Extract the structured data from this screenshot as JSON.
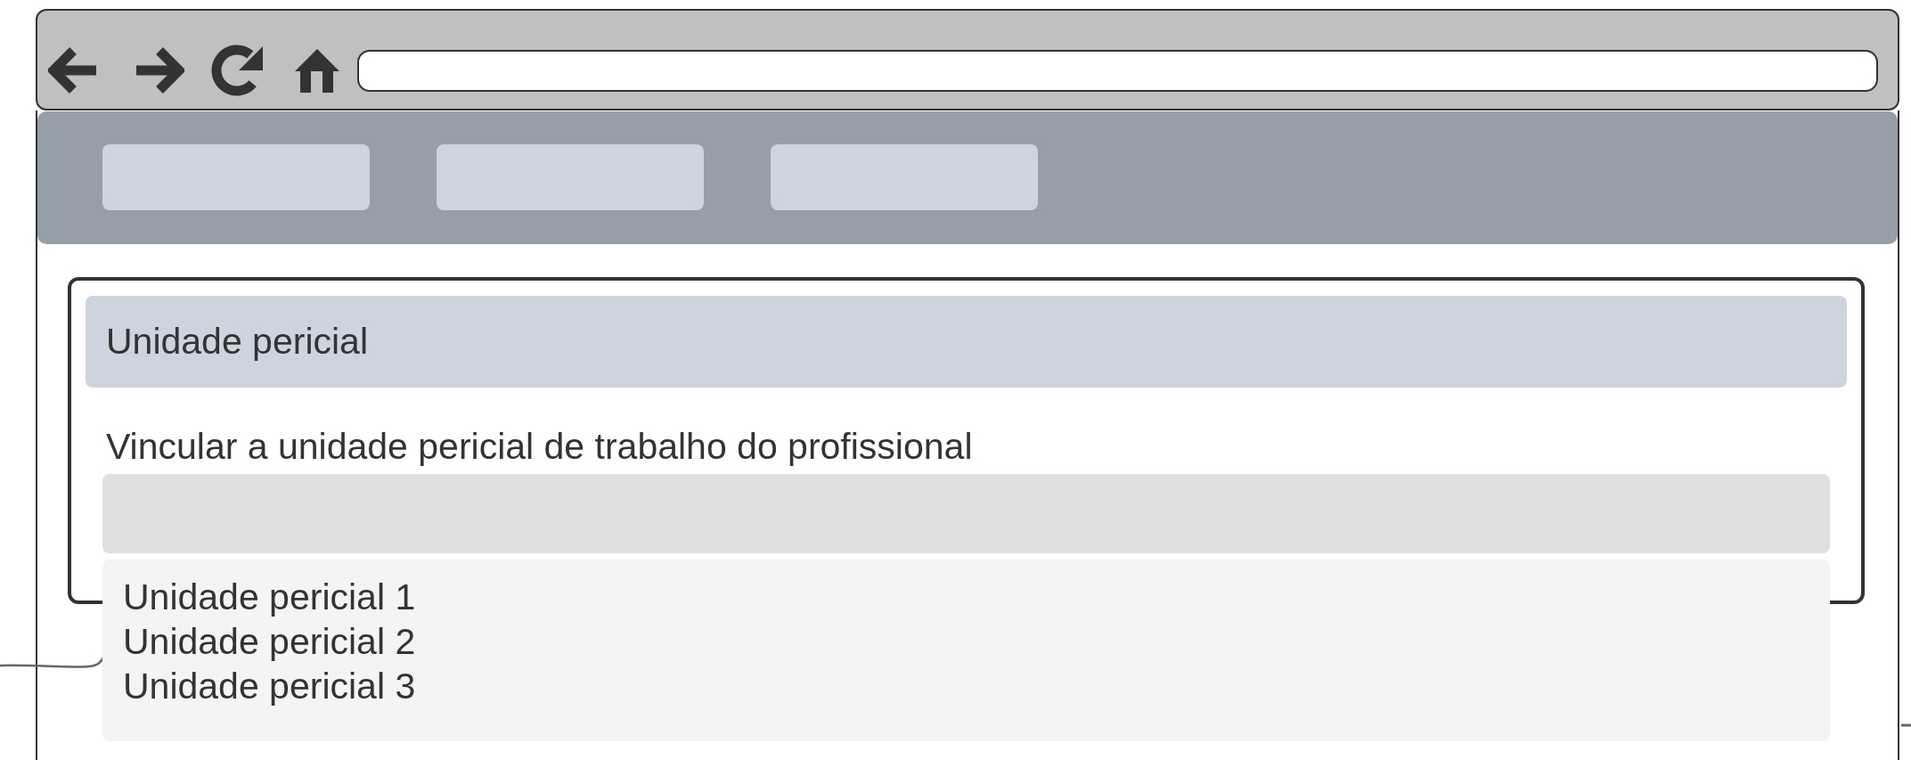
{
  "panel": {
    "title": "Unidade pericial",
    "field": {
      "label": "Vincular a unidade pericial de trabalho do profissional"
    },
    "dropdown": {
      "expanded": true,
      "options": [
        {
          "label": "Unidade pericial 1",
          "selected": false
        },
        {
          "label": "Unidade pericial 2",
          "selected": false
        },
        {
          "label": "Unidade pericial 3",
          "selected": false
        }
      ]
    }
  }
}
